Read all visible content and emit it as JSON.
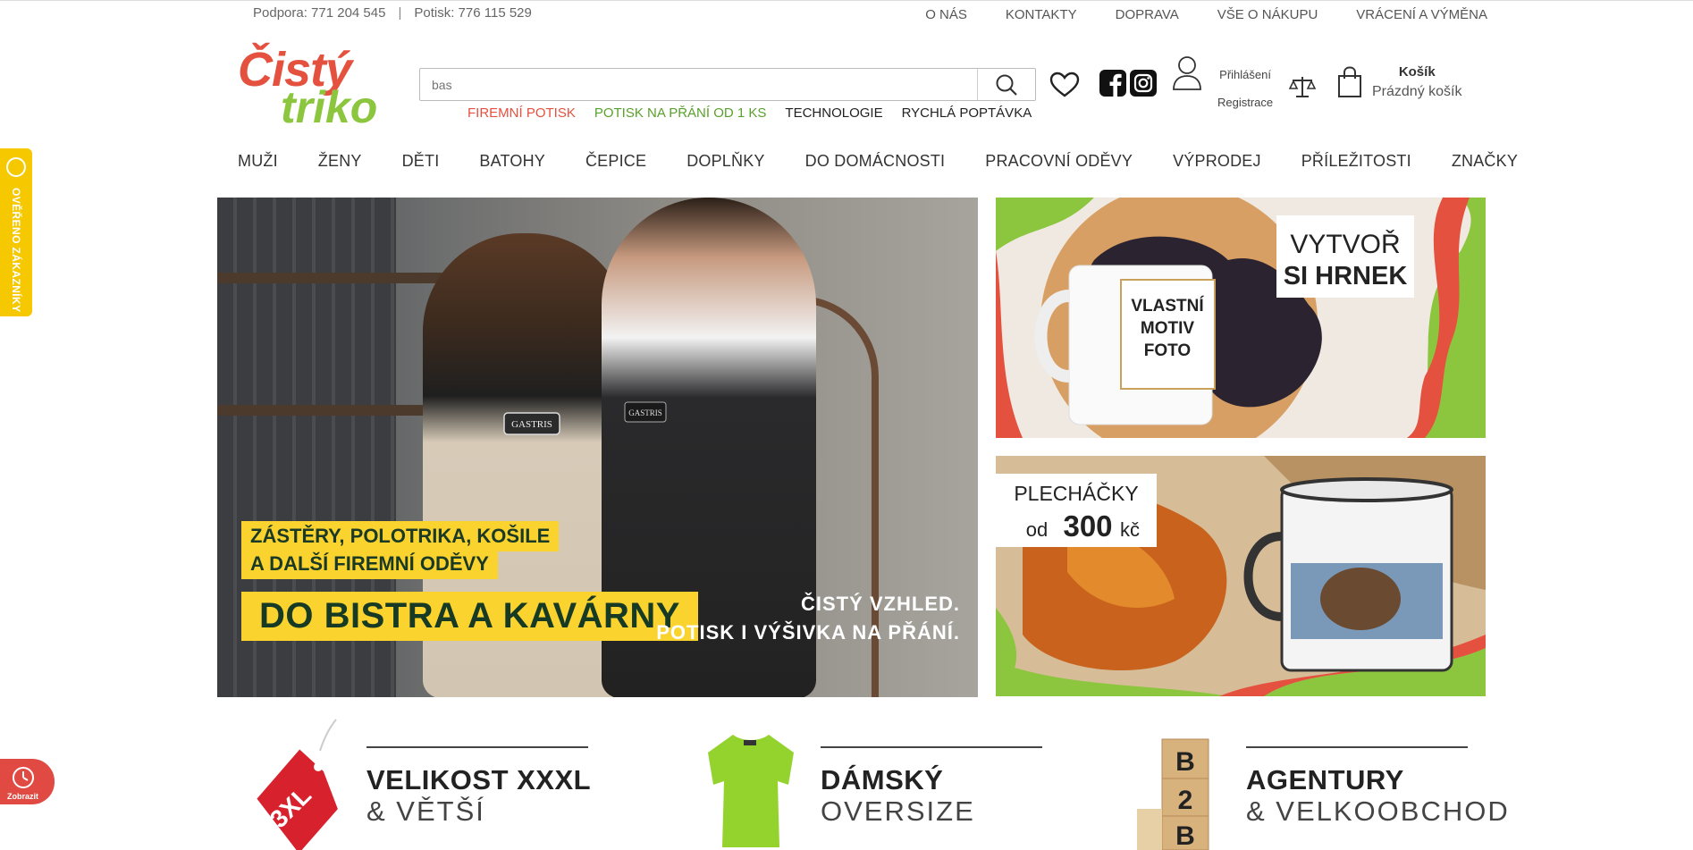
{
  "topbar": {
    "support": "Podpora: 771 204 545",
    "separator": "|",
    "print_phone": "Potisk: 776 115 529",
    "links": [
      "O NÁS",
      "KONTAKTY",
      "DOPRAVA",
      "VŠE O NÁKUPU",
      "VRÁCENÍ A VÝMĚNA"
    ]
  },
  "logo": {
    "line1": "Čistý",
    "line2": "triko"
  },
  "search": {
    "value": "",
    "placeholder": "bas"
  },
  "sublinks": [
    {
      "label": "FIREMNÍ POTISK",
      "color": "#e4513f"
    },
    {
      "label": "POTISK NA PŘÁNÍ OD 1 KS",
      "color": "#5aa02c"
    },
    {
      "label": "TECHNOLOGIE",
      "color": "#222222"
    },
    {
      "label": "RYCHLÁ POPTÁVKA",
      "color": "#222222"
    }
  ],
  "header": {
    "login": "Přihlášení",
    "register": "Registrace",
    "cart_title": "Košík",
    "cart_status": "Prázdný košík",
    "icons": [
      "heart-icon",
      "facebook-icon",
      "instagram-icon",
      "user-icon",
      "compare-scale-icon",
      "cart-bag-icon"
    ]
  },
  "main_nav": [
    "MUŽI",
    "ŽENY",
    "DĚTI",
    "BATOHY",
    "ČEPICE",
    "DOPLŇKY",
    "DO DOMÁCNOSTI",
    "PRACOVNÍ ODĚVY",
    "VÝPRODEJ",
    "PŘÍLEŽITOSTI",
    "ZNAČKY"
  ],
  "hero": {
    "line1": "ZÁSTĚRY, POLOTRIKA, KOŠILE",
    "line2": "A DALŠÍ FIREMNÍ ODĚVY",
    "headline": "DO BISTRA A KAVÁRNY",
    "tag1": "ČISTÝ VZHLED.",
    "tag2": "POTISK I VÝŠIVKA NA PŘÁNÍ.",
    "apron1_logo": "GASTRIS",
    "apron2_logo": "GASTRIS"
  },
  "banner_mug": {
    "title1": "VYTVOŘ",
    "title2": "SI HRNEK",
    "mug_line1": "VLASTNÍ",
    "mug_line2": "MOTIV",
    "mug_line3": "FOTO"
  },
  "banner_tin": {
    "title": "PLECHÁČKY",
    "prefix": "od",
    "price": "300",
    "currency": "kč"
  },
  "categories": [
    {
      "title": "VELIKOST XXXL",
      "subtitle": "& VĚTŠÍ",
      "tag": "3XL"
    },
    {
      "title": "DÁMSKÝ",
      "subtitle": "OVERSIZE"
    },
    {
      "title": "AGENTURY",
      "subtitle": "& VELKOOBCHOD",
      "blocks": [
        "B",
        "2",
        "B"
      ]
    }
  ],
  "side_widget": {
    "label": "OVĚŘENO ZÁKAZNÍKY"
  },
  "clock_widget": {
    "label": "Zobrazit"
  },
  "colors": {
    "brand_red": "#e4513f",
    "brand_green": "#8cc63f",
    "hero_yellow": "#fbd32f",
    "dark_green": "#163a24",
    "widget_yellow": "#f5c800",
    "widget_red": "#e04a43"
  }
}
